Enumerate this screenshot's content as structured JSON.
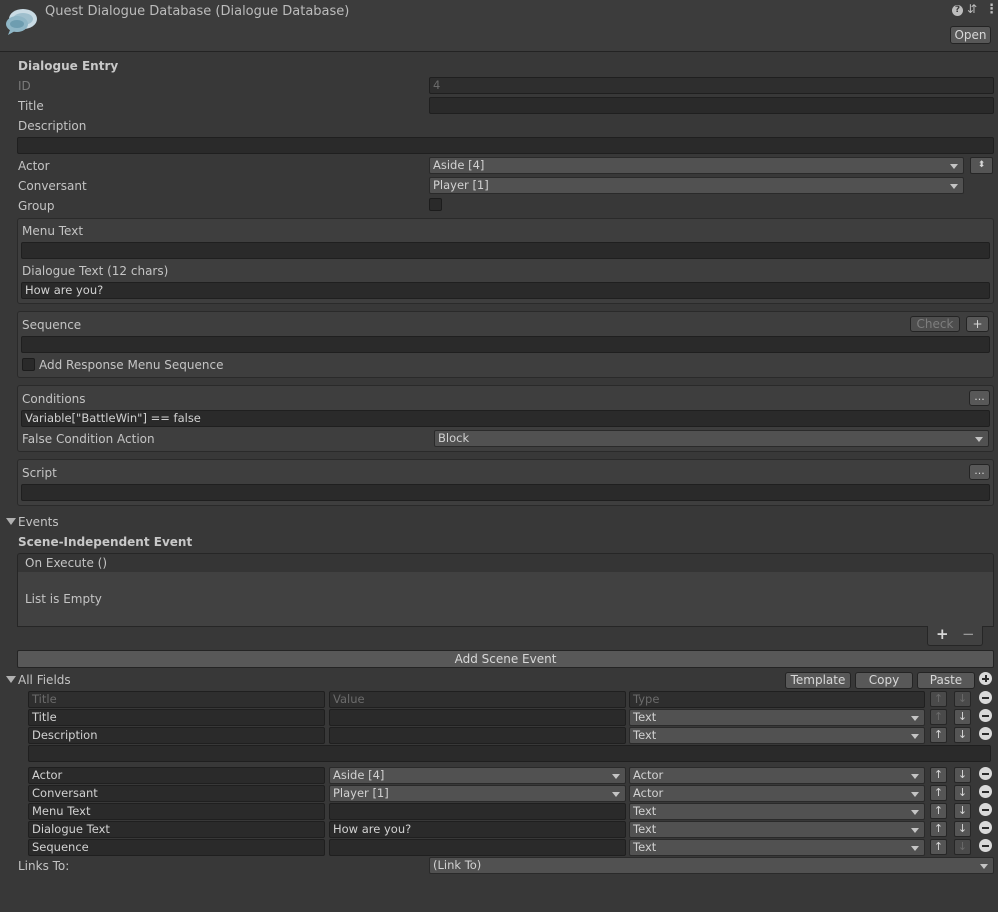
{
  "header": {
    "title": "Quest Dialogue Database (Dialogue Database)",
    "open_label": "Open",
    "help_icon": "?",
    "sliders_icon": "⇵",
    "more_icon": "⋮"
  },
  "entry": {
    "section_title": "Dialogue Entry",
    "id_label": "ID",
    "id_value": "4",
    "title_label": "Title",
    "title_value": "",
    "description_label": "Description",
    "description_value": "",
    "actor_label": "Actor",
    "actor_value": "Aside [4]",
    "conversant_label": "Conversant",
    "conversant_value": "Player [1]",
    "group_label": "Group",
    "menu_text_label": "Menu Text",
    "menu_text_value": "",
    "dialogue_text_label": "Dialogue Text (12 chars)",
    "dialogue_text_value": "How are you?"
  },
  "sequence": {
    "label": "Sequence",
    "check_label": "Check",
    "plus_label": "+",
    "value": "",
    "add_response_label": "Add Response Menu Sequence"
  },
  "conditions": {
    "label": "Conditions",
    "more_label": "...",
    "value": "Variable[\"BattleWin\"] == false",
    "false_action_label": "False Condition Action",
    "false_action_value": "Block"
  },
  "script": {
    "label": "Script",
    "more_label": "...",
    "value": ""
  },
  "events": {
    "label": "Events",
    "scene_independent_label": "Scene-Independent Event",
    "on_execute_label": "On Execute ()",
    "list_empty_label": "List is Empty",
    "plus_label": "+",
    "minus_label": "−",
    "add_scene_event_label": "Add Scene Event"
  },
  "all_fields": {
    "label": "All Fields",
    "template_label": "Template",
    "copy_label": "Copy",
    "paste_label": "Paste",
    "headers": {
      "title": "Title",
      "value": "Value",
      "type": "Type"
    },
    "up": "↑",
    "down": "↓",
    "rows": [
      {
        "title": "Title",
        "value": "",
        "value_is_dropdown": false,
        "type": "Text"
      },
      {
        "title": "Description",
        "value": "",
        "value_is_dropdown": false,
        "type": "Text"
      },
      {
        "title": "Actor",
        "value": "Aside [4]",
        "value_is_dropdown": true,
        "type": "Actor"
      },
      {
        "title": "Conversant",
        "value": "Player [1]",
        "value_is_dropdown": true,
        "type": "Actor"
      },
      {
        "title": "Menu Text",
        "value": "",
        "value_is_dropdown": false,
        "type": "Text"
      },
      {
        "title": "Dialogue Text",
        "value": "How are you?",
        "value_is_dropdown": false,
        "type": "Text"
      },
      {
        "title": "Sequence",
        "value": "",
        "value_is_dropdown": false,
        "type": "Text"
      }
    ]
  },
  "links": {
    "label": "Links To:",
    "value": "(Link To)"
  }
}
